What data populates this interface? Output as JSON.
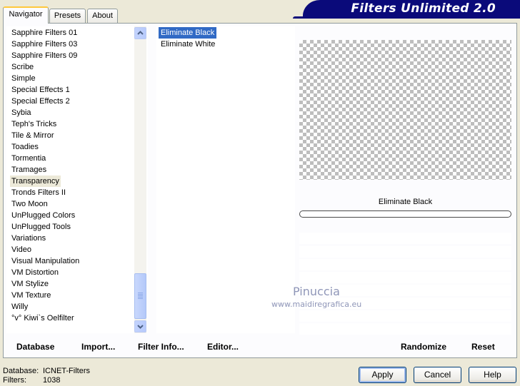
{
  "tabs": [
    {
      "label": "Navigator"
    },
    {
      "label": "Presets"
    },
    {
      "label": "About"
    }
  ],
  "banner_title": "Filters Unlimited 2.0",
  "categories": {
    "items": [
      "Sapphire Filters 01",
      "Sapphire Filters 03",
      "Sapphire Filters 09",
      "Scribe",
      "Simple",
      "Special Effects 1",
      "Special Effects 2",
      "Sybia",
      "Teph's Tricks",
      "Tile & Mirror",
      "Toadies",
      "Tormentia",
      "Tramages",
      "Transparency",
      "Tronds Filters II",
      "Two Moon",
      "UnPlugged Colors",
      "UnPlugged Tools",
      "Variations",
      "Video",
      "Visual Manipulation",
      "VM Distortion",
      "VM Stylize",
      "VM Texture",
      "Willy",
      "°v° Kiwi`s Oelfilter"
    ],
    "selected": "Transparency"
  },
  "filters": {
    "items": [
      "Eliminate Black",
      "Eliminate White"
    ],
    "selected": "Eliminate Black"
  },
  "preview": {
    "filter_name": "Eliminate Black"
  },
  "watermark": {
    "name": "Pinuccia",
    "url": "www.maidiregrafica.eu"
  },
  "actions": {
    "database": "Database",
    "import": "Import...",
    "filter_info": "Filter Info...",
    "editor": "Editor...",
    "randomize": "Randomize",
    "reset": "Reset"
  },
  "status": {
    "database_label": "Database:",
    "database_value": "ICNET-Filters",
    "filters_label": "Filters:",
    "filters_value": "1038"
  },
  "buttons": {
    "apply": "Apply",
    "cancel": "Cancel",
    "help": "Help"
  },
  "colors": {
    "banner": "#0a0a7a",
    "selection": "#316ac5",
    "dialog_bg": "#ece9d8"
  }
}
